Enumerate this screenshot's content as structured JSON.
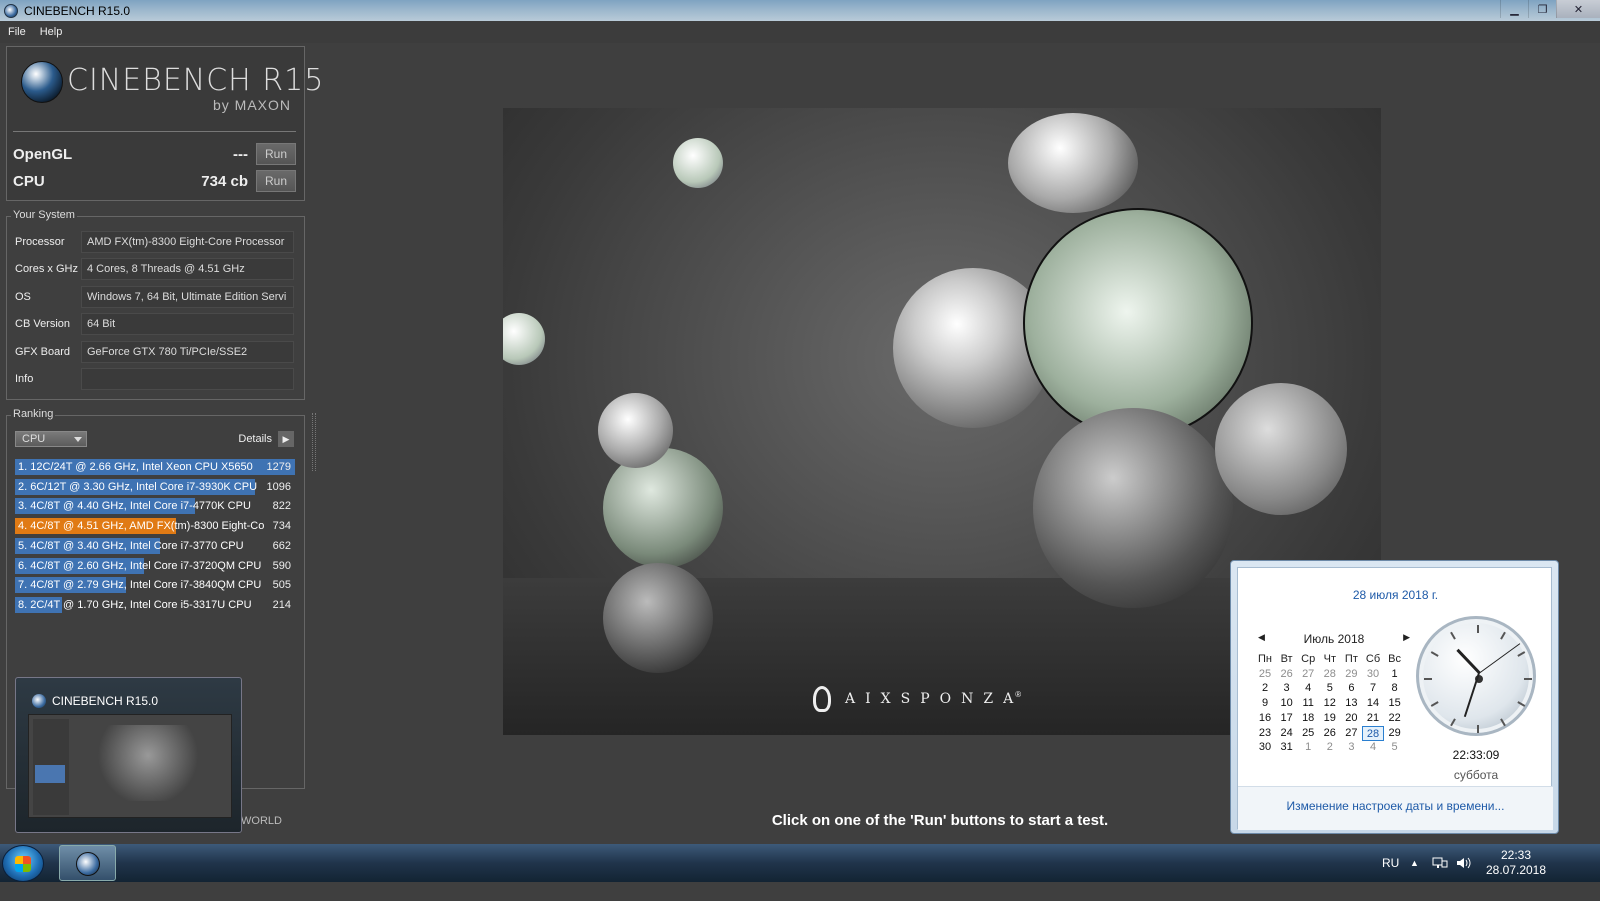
{
  "window": {
    "title": "CINEBENCH R15.0",
    "min": "▁",
    "max": "❐",
    "close": "✕"
  },
  "menu": {
    "file": "File",
    "help": "Help"
  },
  "logo": {
    "brand": "CINEBENCH R15",
    "by": "by MAXON"
  },
  "benchmarks": {
    "opengl": {
      "label": "OpenGL",
      "value": "---",
      "run": "Run"
    },
    "cpu": {
      "label": "CPU",
      "value": "734 cb",
      "run": "Run"
    }
  },
  "system": {
    "title": "Your System",
    "rows": [
      {
        "key": "Processor",
        "value": "AMD FX(tm)-8300 Eight-Core Processor"
      },
      {
        "key": "Cores x GHz",
        "value": "4 Cores, 8 Threads @ 4.51 GHz"
      },
      {
        "key": "OS",
        "value": "Windows 7, 64 Bit, Ultimate Edition Servi"
      },
      {
        "key": "CB Version",
        "value": "64 Bit"
      },
      {
        "key": "GFX Board",
        "value": "GeForce GTX 780 Ti/PCIe/SSE2"
      },
      {
        "key": "Info",
        "value": ""
      }
    ]
  },
  "ranking": {
    "title": "Ranking",
    "filter": "CPU",
    "details": "Details",
    "details_arrow": "▶",
    "max_score": 1279,
    "items": [
      {
        "label": "1. 12C/24T @ 2.66 GHz, Intel Xeon CPU X5650",
        "score": 1279,
        "score_text": "1279",
        "highlight": false
      },
      {
        "label": "2. 6C/12T @ 3.30 GHz,  Intel Core i7-3930K CPU",
        "score": 1096,
        "score_text": "1096",
        "highlight": false
      },
      {
        "label": "3. 4C/8T @ 4.40 GHz, Intel Core i7-4770K CPU",
        "score": 822,
        "score_text": "822",
        "highlight": false
      },
      {
        "label": "4. 4C/8T @ 4.51 GHz, AMD FX(tm)-8300 Eight-Co",
        "score": 734,
        "score_text": "734",
        "highlight": true
      },
      {
        "label": "5. 4C/8T @ 3.40 GHz,  Intel Core i7-3770 CPU",
        "score": 662,
        "score_text": "662",
        "highlight": false
      },
      {
        "label": "6. 4C/8T @ 2.60 GHz, Intel Core i7-3720QM CPU",
        "score": 590,
        "score_text": "590",
        "highlight": false
      },
      {
        "label": "7. 4C/8T @ 2.79 GHz,  Intel Core i7-3840QM CPU",
        "score": 505,
        "score_text": "505",
        "highlight": false
      },
      {
        "label": "8. 2C/4T @ 1.70 GHz,  Intel Core i5-3317U CPU",
        "score": 214,
        "score_text": "214",
        "highlight": false
      }
    ],
    "colors": {
      "bar": "#3f73b3",
      "highlight": "#e07a14"
    }
  },
  "render": {
    "watermark": "AIXSPONZA",
    "trademark": "®"
  },
  "status": "Click on one of the 'Run' buttons to start a test.",
  "partial_world": "WORLD",
  "taskbar_preview": {
    "title": "CINEBENCH R15.0"
  },
  "tray": {
    "lang": "RU",
    "time": "22:33",
    "date": "28.07.2018"
  },
  "calendar": {
    "full_date": "28 июля 2018 г.",
    "month": "Июль 2018",
    "prev": "◀",
    "next": "▶",
    "weekdays": [
      "Пн",
      "Вт",
      "Ср",
      "Чт",
      "Пт",
      "Сб",
      "Вс"
    ],
    "weeks": [
      [
        "25",
        "26",
        "27",
        "28",
        "29",
        "30",
        "1"
      ],
      [
        "2",
        "3",
        "4",
        "5",
        "6",
        "7",
        "8"
      ],
      [
        "9",
        "10",
        "11",
        "12",
        "13",
        "14",
        "15"
      ],
      [
        "16",
        "17",
        "18",
        "19",
        "20",
        "21",
        "22"
      ],
      [
        "23",
        "24",
        "25",
        "26",
        "27",
        "28",
        "29"
      ],
      [
        "30",
        "31",
        "1",
        "2",
        "3",
        "4",
        "5"
      ]
    ],
    "today": "28",
    "clock_time": "22:33:09",
    "clock_h": 22,
    "clock_m": 33,
    "clock_s": 9,
    "weekday_name": "суббота",
    "settings_link": "Изменение настроек даты и времени..."
  }
}
